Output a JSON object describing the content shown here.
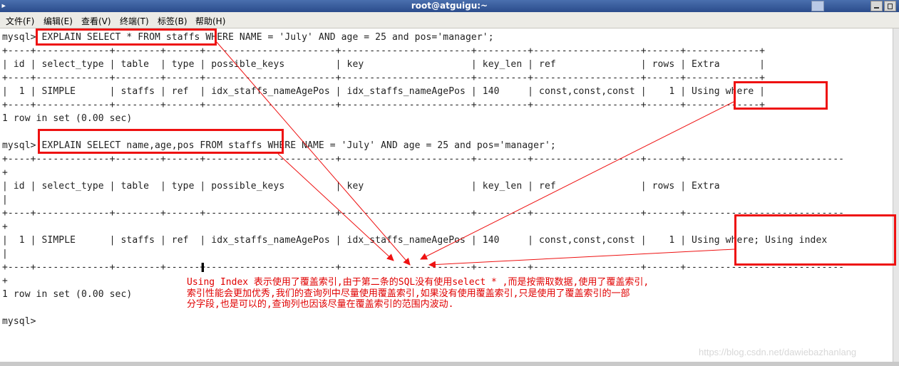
{
  "window": {
    "title": "root@atguigu:~"
  },
  "menu": [
    {
      "label": "文件(F)"
    },
    {
      "label": "编辑(E)"
    },
    {
      "label": "查看(V)"
    },
    {
      "label": "终端(T)"
    },
    {
      "label": "标签(B)"
    },
    {
      "label": "帮助(H)"
    }
  ],
  "terminal": {
    "lines": [
      "mysql> EXPLAIN SELECT * FROM staffs WHERE NAME = 'July' AND age = 25 and pos='manager';",
      "+----+-------------+--------+------+-----------------------+-----------------------+---------+-------------------+------+-------------+",
      "| id | select_type | table  | type | possible_keys         | key                   | key_len | ref               | rows | Extra       |",
      "+----+-------------+--------+------+-----------------------+-----------------------+---------+-------------------+------+-------------+",
      "|  1 | SIMPLE      | staffs | ref  | idx_staffs_nameAgePos | idx_staffs_nameAgePos | 140     | const,const,const |    1 | Using where |",
      "+----+-------------+--------+------+-----------------------+-----------------------+---------+-------------------+------+-------------+",
      "1 row in set (0.00 sec)",
      "",
      "mysql> EXPLAIN SELECT name,age,pos FROM staffs WHERE NAME = 'July' AND age = 25 and pos='manager';",
      "+----+-------------+--------+------+-----------------------+-----------------------+---------+-------------------+------+----------------------------",
      "+",
      "| id | select_type | table  | type | possible_keys         | key                   | key_len | ref               | rows | Extra",
      "|",
      "+----+-------------+--------+------+-----------------------+-----------------------+---------+-------------------+------+----------------------------",
      "+",
      "|  1 | SIMPLE      | staffs | ref  | idx_staffs_nameAgePos | idx_staffs_nameAgePos | 140     | const,const,const |    1 | Using where; Using index",
      "|",
      "+----+-------------+--------+------+-----------------------+-----------------------+---------+-------------------+------+----------------------------",
      "+",
      "1 row in set (0.00 sec)",
      "",
      "mysql>"
    ]
  },
  "annotation": {
    "line1": "Using Index 表示使用了覆盖索引,由于第二条的SQL没有使用select * ,而是按需取数据,使用了覆盖索引,",
    "line2": "索引性能会更加优秀,我们的查询列中尽量使用覆盖索引,如果没有使用覆盖索引,只是使用了覆盖索引的一部",
    "line3": "分字段,也是可以的,查询列也因该尽量在覆盖索引的范围内波动."
  },
  "watermark": "https://blog.csdn.net/dawiebazhanlang",
  "colors": {
    "highlight": "#ee1111",
    "annotation_text": "#e00000",
    "titlebar": "#2b4c8c"
  }
}
